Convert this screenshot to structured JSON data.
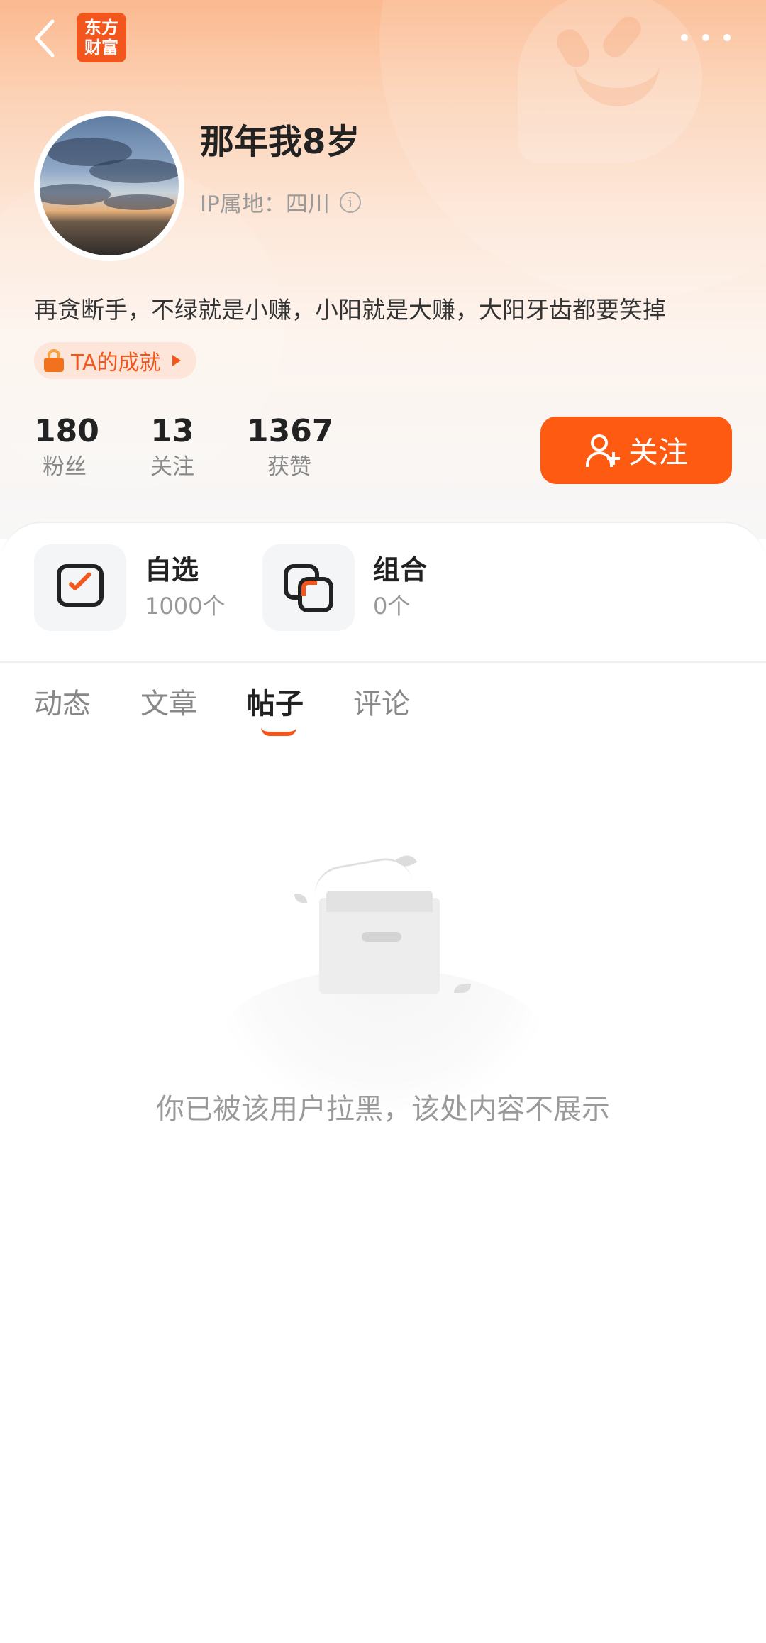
{
  "header": {
    "logo_line1": "东方",
    "logo_line2": "财富",
    "back_icon": "chevron-left-icon",
    "more_icon": "more-horizontal-icon"
  },
  "profile": {
    "username": "那年我8岁",
    "ip_label": "IP属地：四川",
    "bio": "再贪断手，不绿就是小赚，小阳就是大赚，大阳牙齿都要笑掉",
    "achievement_label": "TA的成就"
  },
  "stats": [
    {
      "value": "180",
      "label": "粉丝"
    },
    {
      "value": "13",
      "label": "关注"
    },
    {
      "value": "1367",
      "label": "获赞"
    }
  ],
  "follow_button": {
    "label": "关注"
  },
  "assets": [
    {
      "title": "自选",
      "sub": "1000个",
      "icon": "watchlist-icon"
    },
    {
      "title": "组合",
      "sub": "0个",
      "icon": "portfolio-icon"
    }
  ],
  "tabs": [
    {
      "label": "动态",
      "active": false
    },
    {
      "label": "文章",
      "active": false
    },
    {
      "label": "帖子",
      "active": true
    },
    {
      "label": "评论",
      "active": false
    }
  ],
  "empty_message": "你已被该用户拉黑，该处内容不展示",
  "colors": {
    "accent": "#ff5a12",
    "brand": "#f2561d",
    "text_primary": "#222222",
    "text_secondary": "#888888"
  }
}
